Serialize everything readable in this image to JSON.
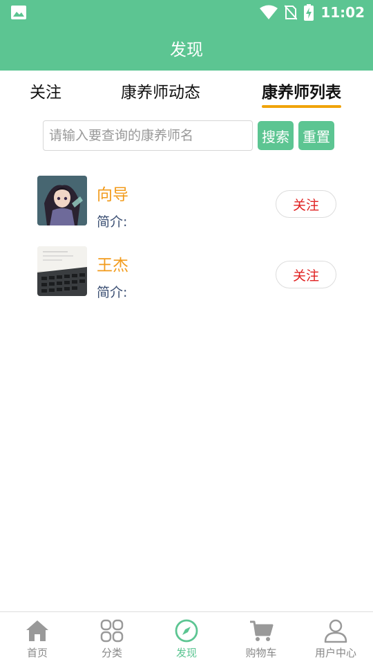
{
  "status_bar": {
    "time": "11:02"
  },
  "header": {
    "title": "发现"
  },
  "tabs": [
    {
      "label": "关注"
    },
    {
      "label": "康养师动态"
    },
    {
      "label": "康养师列表",
      "active": true
    }
  ],
  "search": {
    "placeholder": "请输入要查询的康养师名",
    "value": "",
    "search_label": "搜索",
    "reset_label": "重置"
  },
  "list": [
    {
      "name": "向导",
      "intro": "简介:",
      "follow_label": "关注"
    },
    {
      "name": "王杰",
      "intro": "简介:",
      "follow_label": "关注"
    }
  ],
  "bottom_nav": [
    {
      "label": "首页",
      "icon": "home-icon"
    },
    {
      "label": "分类",
      "icon": "grid-icon"
    },
    {
      "label": "发现",
      "icon": "compass-icon",
      "active": true
    },
    {
      "label": "购物车",
      "icon": "cart-icon"
    },
    {
      "label": "用户中心",
      "icon": "user-icon"
    }
  ],
  "colors": {
    "primary": "#5cc592",
    "accent_underline": "#f0a30a",
    "name_orange": "#f29b1b",
    "follow_red": "#e02020",
    "intro_blue": "#3b4f73"
  }
}
